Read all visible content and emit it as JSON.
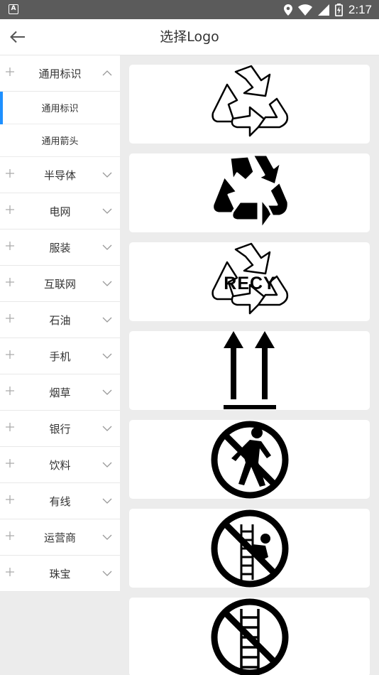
{
  "statusbar": {
    "time": "2:17",
    "left_badge": "A"
  },
  "appbar": {
    "title": "选择Logo"
  },
  "sidebar": {
    "categories": [
      {
        "label": "通用标识",
        "expanded": true,
        "children": [
          {
            "label": "通用标识",
            "active": true
          },
          {
            "label": "通用箭头",
            "active": false
          }
        ]
      },
      {
        "label": "半导体"
      },
      {
        "label": "电网"
      },
      {
        "label": "服装"
      },
      {
        "label": "互联网"
      },
      {
        "label": "石油"
      },
      {
        "label": "手机"
      },
      {
        "label": "烟草"
      },
      {
        "label": "银行"
      },
      {
        "label": "饮料"
      },
      {
        "label": "有线"
      },
      {
        "label": "运营商"
      },
      {
        "label": "珠宝"
      }
    ]
  },
  "logos": [
    {
      "icon": "recycle-outline-icon"
    },
    {
      "icon": "recycle-filled-icon"
    },
    {
      "icon": "recycle-text-icon",
      "text": "RECY"
    },
    {
      "icon": "this-way-up-icon"
    },
    {
      "icon": "no-pedestrian-icon"
    },
    {
      "icon": "no-climbing-icon"
    },
    {
      "icon": "no-ladder-icon"
    }
  ],
  "colors": {
    "accent": "#1e90ff",
    "background": "#ececec",
    "statusbar": "#5b5b5b"
  }
}
